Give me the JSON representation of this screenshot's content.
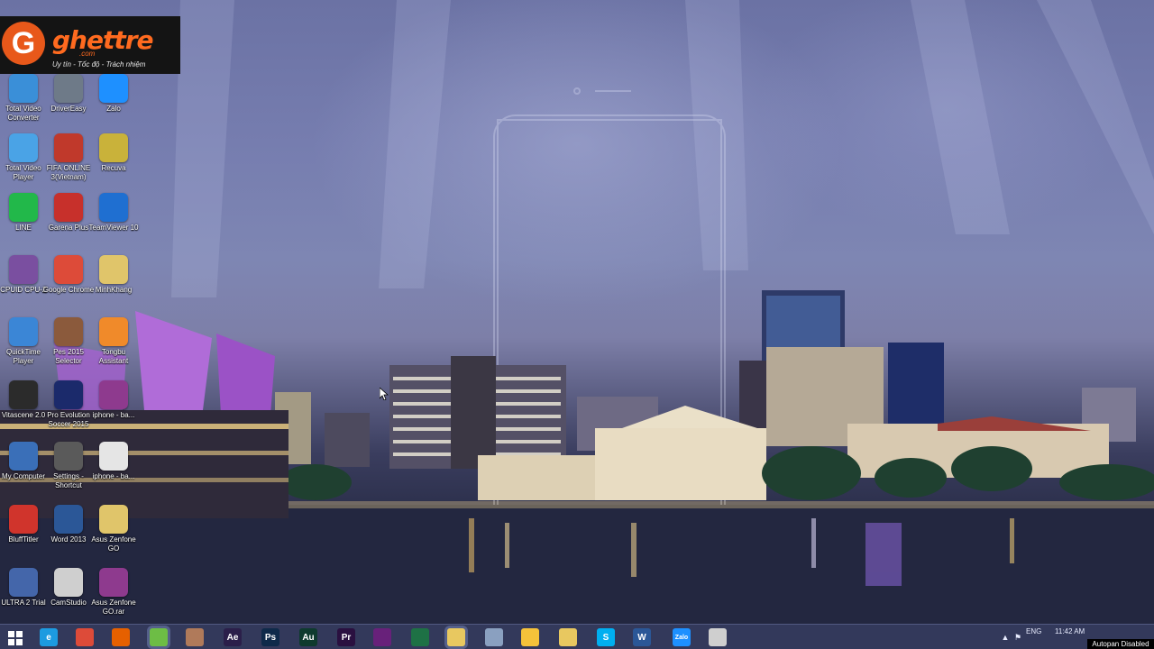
{
  "logo": {
    "brand": "ghettre",
    "domain": ".com",
    "tagline": "Uy tín - Tốc độ - Trách nhiệm"
  },
  "desktop_icons": [
    {
      "label": "Total Video Converter",
      "icon": "total-video-converter-icon",
      "color": "#3a8fd8"
    },
    {
      "label": "DriverEasy",
      "icon": "drivereasy-icon",
      "color": "#6e7a88"
    },
    {
      "label": "Zalo",
      "icon": "zalo-icon",
      "color": "#1e90ff"
    },
    {
      "label": "Total Video Player",
      "icon": "total-video-player-icon",
      "color": "#4aa3e6"
    },
    {
      "label": "FIFA ONLINE 3(Vietnam)",
      "icon": "fifa-online-icon",
      "color": "#c0392b"
    },
    {
      "label": "Recuva",
      "icon": "recuva-icon",
      "color": "#c9b23a"
    },
    {
      "label": "LINE",
      "icon": "line-icon",
      "color": "#22b84a"
    },
    {
      "label": "Garena Plus",
      "icon": "garena-plus-icon",
      "color": "#c7302b"
    },
    {
      "label": "TeamViewer 10",
      "icon": "teamviewer-icon",
      "color": "#1f6fd1"
    },
    {
      "label": "CPUID CPU-Z",
      "icon": "cpu-z-icon",
      "color": "#7a4fa0"
    },
    {
      "label": "Google Chrome",
      "icon": "google-chrome-icon",
      "color": "#dd4b39"
    },
    {
      "label": "MinhKhang",
      "icon": "folder-icon",
      "color": "#e0c56a"
    },
    {
      "label": "QuickTime Player",
      "icon": "quicktime-icon",
      "color": "#3b86d6"
    },
    {
      "label": "Pes 2015 Selector",
      "icon": "pes-selector-icon",
      "color": "#8b5a3c"
    },
    {
      "label": "Tongbu Assistant",
      "icon": "tongbu-icon",
      "color": "#f08a2a"
    },
    {
      "label": "Vitascene 2.0",
      "icon": "vitascene-icon",
      "color": "#2b2b2b"
    },
    {
      "label": "Pro Evolution Soccer 2015",
      "icon": "pes-2015-icon",
      "color": "#1b2a6b"
    },
    {
      "label": "iphone - ba...",
      "icon": "winrar-archive-icon",
      "color": "#8e3a8e"
    },
    {
      "label": "My Computer",
      "icon": "computer-icon",
      "color": "#3a6fb8"
    },
    {
      "label": "Settings - Shortcut",
      "icon": "settings-icon",
      "color": "#5a5a5a"
    },
    {
      "label": "iphone - ba...",
      "icon": "document-icon",
      "color": "#e5e5e5"
    },
    {
      "label": "BluffTitler",
      "icon": "blufftitler-icon",
      "color": "#d0342c"
    },
    {
      "label": "Word 2013",
      "icon": "word-icon",
      "color": "#2b5797"
    },
    {
      "label": "Asus Zenfone GO",
      "icon": "folder-icon",
      "color": "#e0c56a"
    },
    {
      "label": "ULTRA 2 Trial",
      "icon": "ultra-icon",
      "color": "#4466aa"
    },
    {
      "label": "CamStudio",
      "icon": "camstudio-icon",
      "color": "#cfcfcf"
    },
    {
      "label": "Asus Zenfone GO.rar",
      "icon": "winrar-archive-icon",
      "color": "#8e3a8e"
    }
  ],
  "taskbar": {
    "items": [
      {
        "name": "internet-explorer-icon",
        "glyph": "e",
        "color": "#1d9be0"
      },
      {
        "name": "chrome-icon",
        "glyph": "",
        "color": "#dd4b39"
      },
      {
        "name": "firefox-icon",
        "glyph": "",
        "color": "#e66000"
      },
      {
        "name": "app-green-icon",
        "glyph": "",
        "color": "#6dbd45"
      },
      {
        "name": "grid-app-icon",
        "glyph": "",
        "color": "#b07a5a"
      },
      {
        "name": "after-effects-icon",
        "glyph": "Ae",
        "color": "#2b1f4a"
      },
      {
        "name": "photoshop-icon",
        "glyph": "Ps",
        "color": "#0f2a4a"
      },
      {
        "name": "audition-icon",
        "glyph": "Au",
        "color": "#0e3a2e"
      },
      {
        "name": "premiere-icon",
        "glyph": "Pr",
        "color": "#2a1040"
      },
      {
        "name": "visual-studio-icon",
        "glyph": "",
        "color": "#68217a"
      },
      {
        "name": "excel-icon",
        "glyph": "",
        "color": "#1e7145"
      },
      {
        "name": "file-explorer-icon",
        "glyph": "",
        "color": "#e8c860"
      },
      {
        "name": "media-app-icon",
        "glyph": "",
        "color": "#8aa0c0"
      },
      {
        "name": "norton-icon",
        "glyph": "",
        "color": "#f5c23a"
      },
      {
        "name": "folder-icon",
        "glyph": "",
        "color": "#e8c860"
      },
      {
        "name": "skype-icon",
        "glyph": "S",
        "color": "#00aff0"
      },
      {
        "name": "word-icon",
        "glyph": "W",
        "color": "#2b5797"
      },
      {
        "name": "zalo-icon",
        "glyph": "Zalo",
        "color": "#1e90ff"
      },
      {
        "name": "camstudio-icon",
        "glyph": "",
        "color": "#cfcfcf"
      }
    ]
  },
  "tray": {
    "language": "ENG",
    "time": "11:42 AM"
  },
  "autopan": "Autopan Disabled"
}
